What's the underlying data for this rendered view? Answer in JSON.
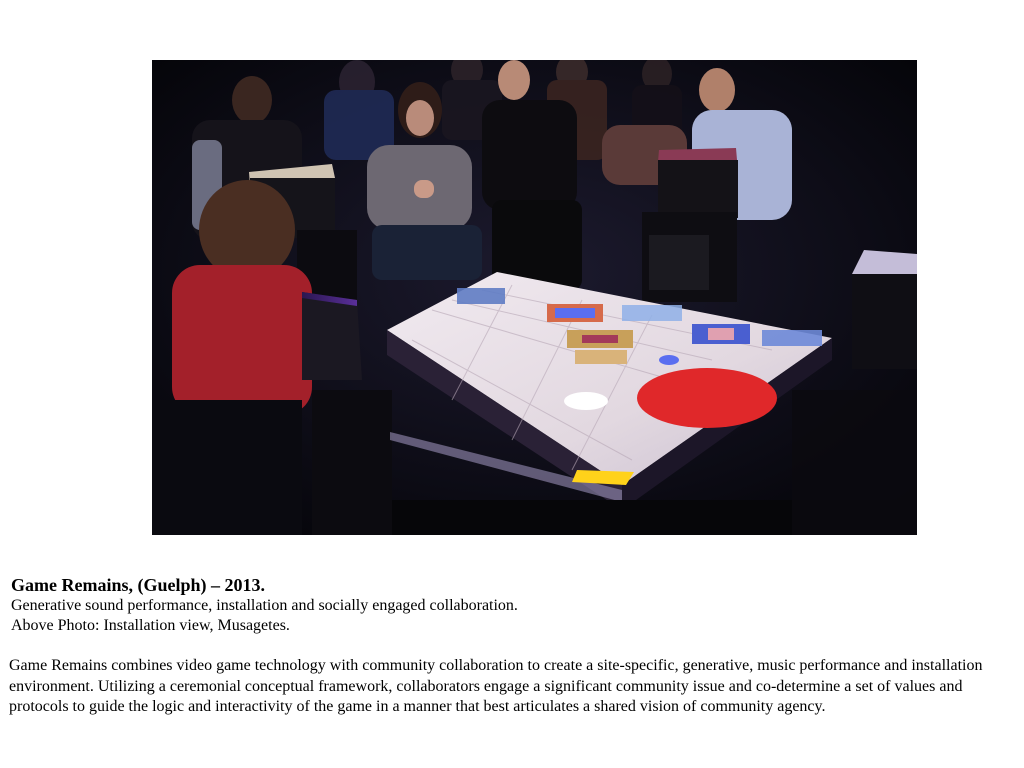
{
  "photo": {
    "subject": "Installation view photograph",
    "colors": {
      "background": "#07070d",
      "table_surface": "#e9e2e6",
      "red_circle": "#e0282a",
      "yellow_square": "#ffd21a",
      "blue_dot": "#5a6ef0"
    }
  },
  "caption": {
    "title": "Game Remains, (Guelph) – 2013.",
    "subtitle": "Generative sound performance, installation and socially engaged collaboration.",
    "credit": "Above Photo: Installation view, Musagetes."
  },
  "description": "Game Remains combines video game technology with community collaboration to create a site-specific, generative, music performance and installation environment. Utilizing a ceremonial conceptual framework, collaborators engage a significant community issue and co-determine a set of values and protocols to guide the logic and interactivity of the game in a manner that best articulates a shared vision of community agency."
}
